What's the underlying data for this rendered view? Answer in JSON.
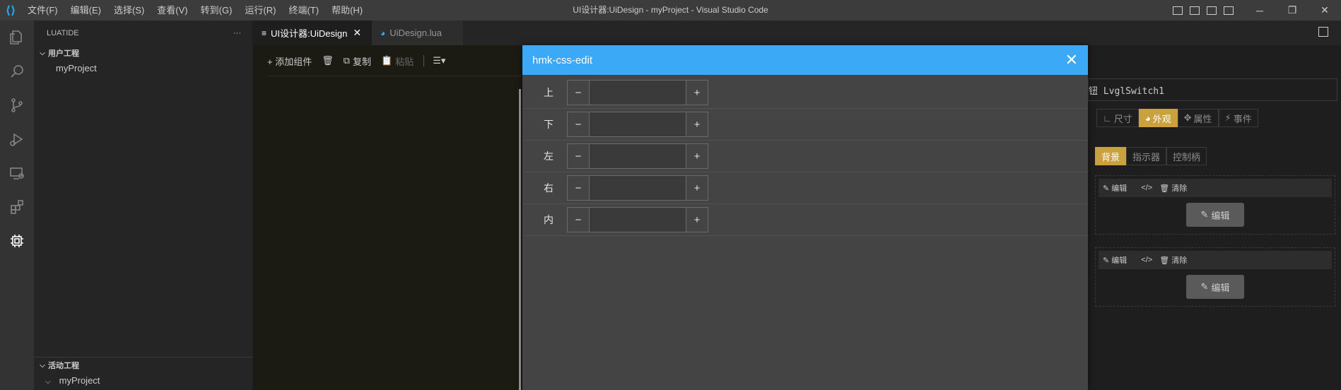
{
  "titlebar": {
    "menu": [
      "文件(F)",
      "编辑(E)",
      "选择(S)",
      "查看(V)",
      "转到(G)",
      "运行(R)",
      "终端(T)",
      "帮助(H)"
    ],
    "window_title": "UI设计器:UiDesign - myProject - Visual Studio Code",
    "minimize": "─",
    "restore": "❐",
    "close": "✕"
  },
  "sidebar": {
    "header": "LUATIDE",
    "more": "···",
    "section1_title": "用户工程",
    "section1_items": [
      "myProject"
    ],
    "section2_title": "活动工程",
    "section2_items": [
      "myProject"
    ]
  },
  "tabs": [
    {
      "label": "UI设计器:UiDesign",
      "icon": "≡",
      "close": "✕"
    },
    {
      "label": "UiDesign.lua",
      "icon": "◕"
    }
  ],
  "toolbar": {
    "add": "+ 添加组件",
    "delete": "🗑",
    "copy": "复制",
    "paste": "粘贴",
    "more": "☰▾"
  },
  "dialog": {
    "title": "hmk-css-edit",
    "close": "✕",
    "minus": "−",
    "plus": "+",
    "rows": [
      {
        "label": "上",
        "value": ""
      },
      {
        "label": "下",
        "value": ""
      },
      {
        "label": "左",
        "value": ""
      },
      {
        "label": "右",
        "value": ""
      },
      {
        "label": "内",
        "value": ""
      }
    ]
  },
  "props": {
    "name": "钮 LvglSwitch1",
    "main_tabs": [
      "尺寸",
      "外观",
      "属性",
      "事件"
    ],
    "main_tab_selected": 1,
    "sub_tabs": [
      "背景",
      "指示器",
      "控制柄"
    ],
    "sub_tab_selected": 0,
    "panel_bar": {
      "edit": "编辑",
      "code": "</>",
      "clear": "清除"
    },
    "panel_button": "编辑"
  },
  "colors": {
    "accent": "#3ba9f5",
    "selected_tab": "#c9a23e",
    "vscode_logo": "#23a9f2"
  }
}
